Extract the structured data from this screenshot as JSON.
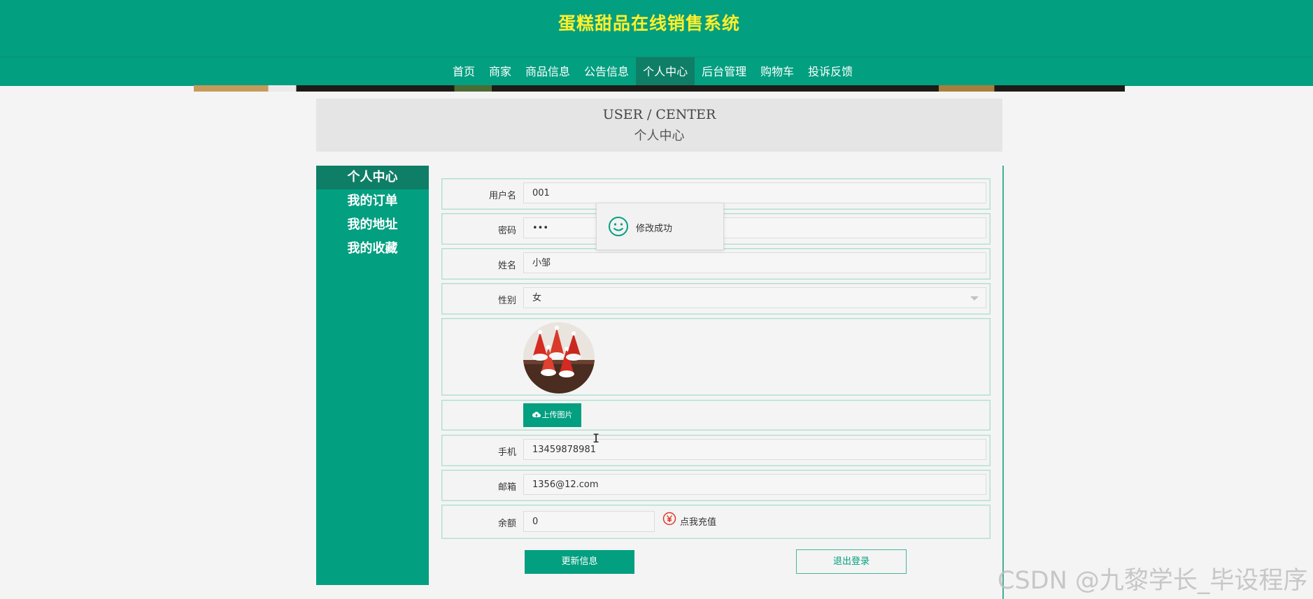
{
  "site": {
    "title": "蛋糕甜品在线销售系统"
  },
  "nav": {
    "items": [
      {
        "label": "首页"
      },
      {
        "label": "商家"
      },
      {
        "label": "商品信息"
      },
      {
        "label": "公告信息"
      },
      {
        "label": "个人中心"
      },
      {
        "label": "后台管理"
      },
      {
        "label": "购物车"
      },
      {
        "label": "投诉反馈"
      }
    ],
    "active": "个人中心"
  },
  "header": {
    "title_en": "USER / CENTER",
    "title_zh": "个人中心"
  },
  "sidebar": {
    "items": [
      {
        "label": "个人中心"
      },
      {
        "label": "我的订单"
      },
      {
        "label": "我的地址"
      },
      {
        "label": "我的收藏"
      }
    ],
    "active": "个人中心"
  },
  "form": {
    "username": {
      "label": "用户名",
      "value": "001"
    },
    "password": {
      "label": "密码",
      "value": "•••"
    },
    "name": {
      "label": "姓名",
      "value": "小邹"
    },
    "gender": {
      "label": "性别",
      "value": "女"
    },
    "upload_label": "上传图片",
    "phone": {
      "label": "手机",
      "value": "13459878981"
    },
    "email": {
      "label": "邮箱",
      "value": "1356@12.com"
    },
    "balance": {
      "label": "余额",
      "value": "0",
      "recharge_label": "点我充值"
    }
  },
  "buttons": {
    "update": "更新信息",
    "logout": "退出登录"
  },
  "toast": {
    "message": "修改成功"
  },
  "watermark": "CSDN @九黎学长_毕设程序",
  "colors": {
    "primary": "#029f80",
    "title_yellow": "#ffef2b",
    "active_dark": "#0f7e67",
    "border": "#b3dccf"
  }
}
